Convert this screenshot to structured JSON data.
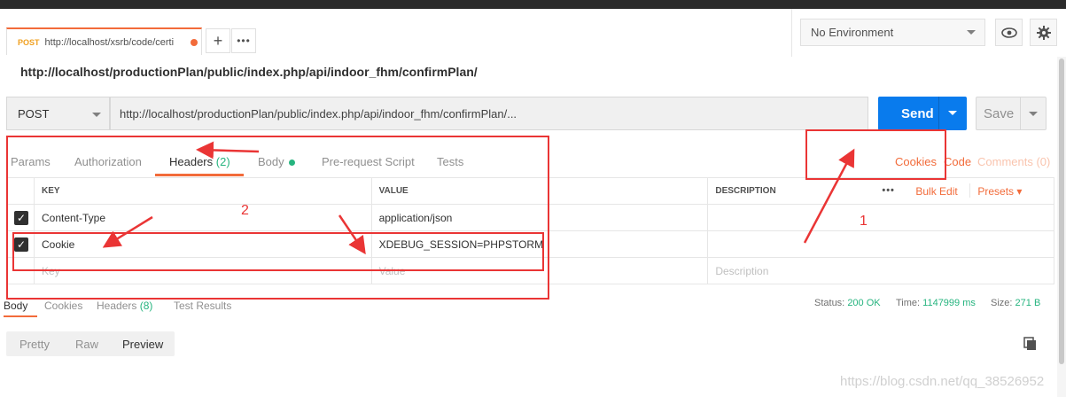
{
  "tab": {
    "method": "POST",
    "url": "http://localhost/xsrb/code/certi"
  },
  "environment": {
    "selected": "No Environment"
  },
  "request": {
    "title": "http://localhost/productionPlan/public/index.php/api/indoor_fhm/confirmPlan/",
    "method": "POST",
    "url": "http://localhost/productionPlan/public/index.php/api/indoor_fhm/confirmPlan/...",
    "send_label": "Send",
    "save_label": "Save"
  },
  "request_tabs": {
    "params": "Params",
    "authorization": "Authorization",
    "headers": "Headers",
    "headers_count": "(2)",
    "body": "Body",
    "prerequest": "Pre-request Script",
    "tests": "Tests",
    "cookies": "Cookies",
    "code": "Code",
    "comments": "Comments (0)"
  },
  "headers_table": {
    "columns": [
      "KEY",
      "VALUE",
      "DESCRIPTION"
    ],
    "more": "•••",
    "bulk_edit": "Bulk Edit",
    "presets": "Presets",
    "rows": [
      {
        "key": "Content-Type",
        "value": "application/json",
        "description": ""
      },
      {
        "key": "Cookie",
        "value": "XDEBUG_SESSION=PHPSTORM",
        "description": ""
      }
    ],
    "placeholder": {
      "key": "Key",
      "value": "Value",
      "description": "Description"
    }
  },
  "response_tabs": {
    "body": "Body",
    "cookies": "Cookies",
    "headers": "Headers",
    "headers_count": "(8)",
    "test_results": "Test Results"
  },
  "response_status": {
    "status_label": "Status:",
    "status_value": "200 OK",
    "time_label": "Time:",
    "time_value": "1147999 ms",
    "size_label": "Size:",
    "size_value": "271 B"
  },
  "format_tabs": {
    "pretty": "Pretty",
    "raw": "Raw",
    "preview": "Preview"
  },
  "annotations": {
    "one": "1",
    "two": "2"
  },
  "watermark": "https://blog.csdn.net/qq_38526952",
  "colors": {
    "accent": "#f26b3a",
    "send": "#097bed",
    "success": "#26b47f",
    "annotation": "#ea3535"
  }
}
